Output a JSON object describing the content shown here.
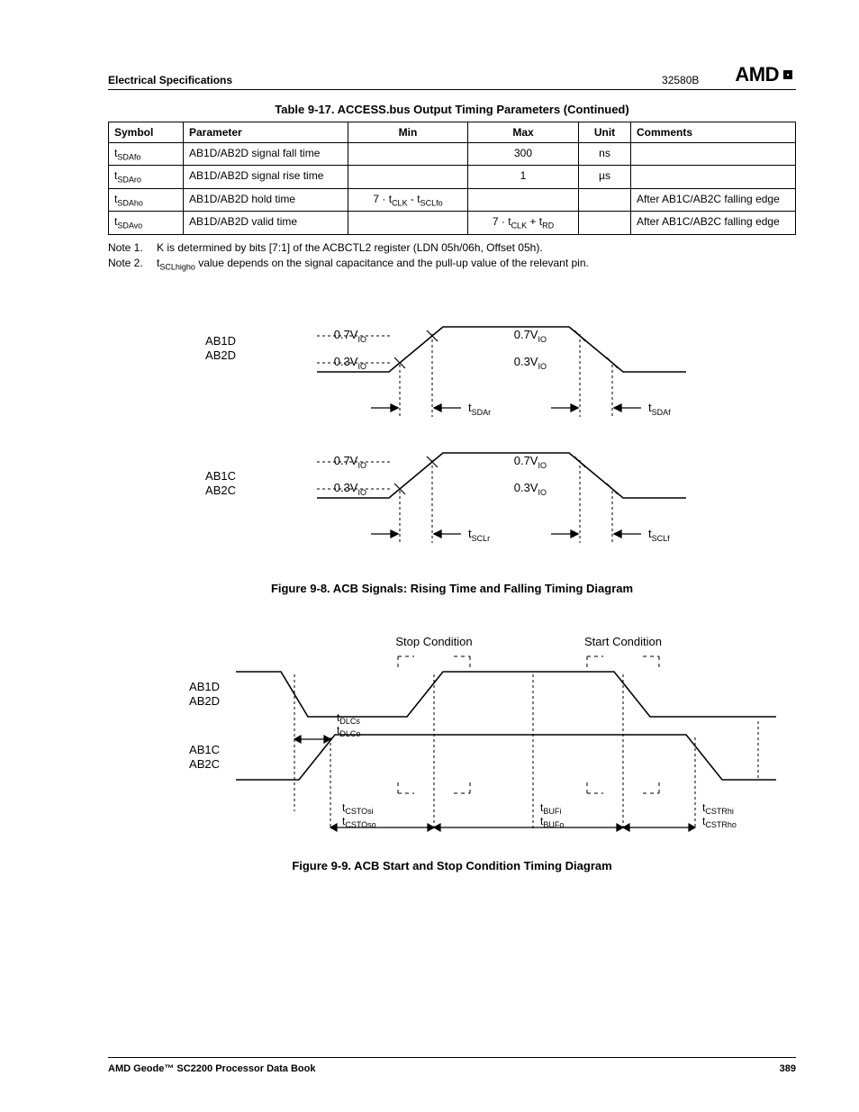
{
  "header": {
    "section": "Electrical Specifications",
    "doc_id": "32580B",
    "brand": "AMD"
  },
  "table": {
    "title": "Table 9-17.  ACCESS.bus Output Timing Parameters  (Continued)",
    "cols": [
      "Symbol",
      "Parameter",
      "Min",
      "Max",
      "Unit",
      "Comments"
    ],
    "rows": [
      {
        "sym_base": "t",
        "sym_sub": "SDAfo",
        "param": "AB1D/AB2D signal fall time",
        "min": "",
        "max": "300",
        "unit": "ns",
        "comments": ""
      },
      {
        "sym_base": "t",
        "sym_sub": "SDAro",
        "param": "AB1D/AB2D signal rise time",
        "min": "",
        "max": "1",
        "unit": "µs",
        "comments": ""
      },
      {
        "sym_base": "t",
        "sym_sub": "SDAho",
        "param": "AB1D/AB2D hold time",
        "min_html": "7 · t<tspan>CLK</tspan> - t<tspan>SCLfo</tspan>",
        "max": "",
        "unit": "",
        "comments": "After AB1C/AB2C falling edge"
      },
      {
        "sym_base": "t",
        "sym_sub": "SDAvo",
        "param": "AB1D/AB2D valid time",
        "min": "",
        "max_html": "7 · t<tspan>CLK</tspan> + t<tspan>RD</tspan>",
        "unit": "",
        "comments": "After AB1C/AB2C falling edge"
      }
    ]
  },
  "notes": {
    "n1_label": "Note 1.",
    "n1_text": "K is determined by bits [7:1] of the ACBCTL2 register (LDN 05h/06h, Offset 05h).",
    "n2_label": "Note 2.",
    "n2_pre": "t",
    "n2_sub": "SCLhigho",
    "n2_post": " value depends on the signal capacitance and the pull-up value of the relevant pin."
  },
  "fig8": {
    "caption": "Figure 9-8.  ACB Signals: Rising Time and Falling Timing Diagram",
    "sig1a": "AB1D",
    "sig1b": "AB2D",
    "sig2a": "AB1C",
    "sig2b": "AB2C",
    "v07": "0.7V",
    "v03": "0.3V",
    "vio": "IO",
    "t_sdar": "SDAr",
    "t_sdaf": "SDAf",
    "t_sclr": "SCLr",
    "t_sclf": "SCLf",
    "t": "t"
  },
  "fig9": {
    "caption": "Figure 9-9.  ACB Start and Stop Condition Timing Diagram",
    "sig1a": "AB1D",
    "sig1b": "AB2D",
    "sig2a": "AB1C",
    "sig2b": "AB2C",
    "stop": "Stop Condition",
    "start": "Start Condition",
    "t": "t",
    "dlcs": "DLCs",
    "dlco": "DLCo",
    "cstosi": "CSTOsi",
    "cstoso": "CSTOso",
    "bufi": "BUFi",
    "bufo": "BUFo",
    "cstrhi": "CSTRhi",
    "cstrho": "CSTRho"
  },
  "footer": {
    "left": "AMD Geode™ SC2200  Processor Data Book",
    "right": "389"
  }
}
